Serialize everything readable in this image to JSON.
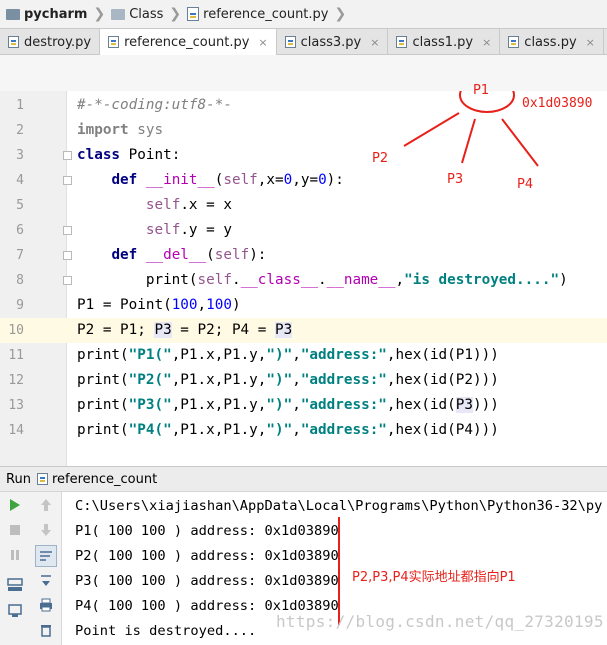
{
  "breadcrumb": {
    "project": "pycharm",
    "folder": "Class",
    "file": "reference_count.py"
  },
  "tabs": [
    {
      "label": "destroy.py",
      "closable": false
    },
    {
      "label": "reference_count.py",
      "closable": true,
      "active": true
    },
    {
      "label": "class3.py",
      "closable": true
    },
    {
      "label": "class1.py",
      "closable": true
    },
    {
      "label": "class.py",
      "closable": true
    }
  ],
  "tab_close_glyph": "×",
  "editor": {
    "line_numbers": [
      "1",
      "2",
      "3",
      "4",
      "5",
      "6",
      "7",
      "8",
      "9",
      "10",
      "11",
      "12",
      "13",
      "14"
    ],
    "current_line": "10"
  },
  "annotations": {
    "p1": "P1",
    "p2": "P2",
    "p3": "P3",
    "p4": "P4",
    "address": "0x1d03890",
    "note": "P2,P3,P4实际地址都指向P1",
    "color": "#e8201a"
  },
  "run": {
    "label": "Run",
    "config": "reference_count",
    "output": [
      "C:\\Users\\xiajiashan\\AppData\\Local\\Programs\\Python\\Python36-32\\py",
      "P1( 100 100 ) address: 0x1d03890",
      "P2( 100 100 ) address: 0x1d03890",
      "P3( 100 100 ) address: 0x1d03890",
      "P4( 100 100 ) address: 0x1d03890",
      "Point is destroyed...."
    ]
  },
  "watermark": "https://blog.csdn.net/qq_27320195",
  "icons": [
    "folder-icon",
    "python-file-icon",
    "close-icon",
    "fold-icon",
    "run-icon",
    "stop-icon",
    "pause-icon",
    "up-arrow-icon",
    "down-arrow-icon",
    "soft-wrap-icon",
    "scroll-to-end-icon",
    "print-icon",
    "trash-icon",
    "layout-icon",
    "pin-icon"
  ],
  "colors": {
    "keyword": "#000080",
    "self": "#94558d",
    "number": "#0000ff",
    "string": "#008080",
    "magic": "#b200b2",
    "comment": "#808080",
    "current_line_bg": "#fffae3"
  }
}
